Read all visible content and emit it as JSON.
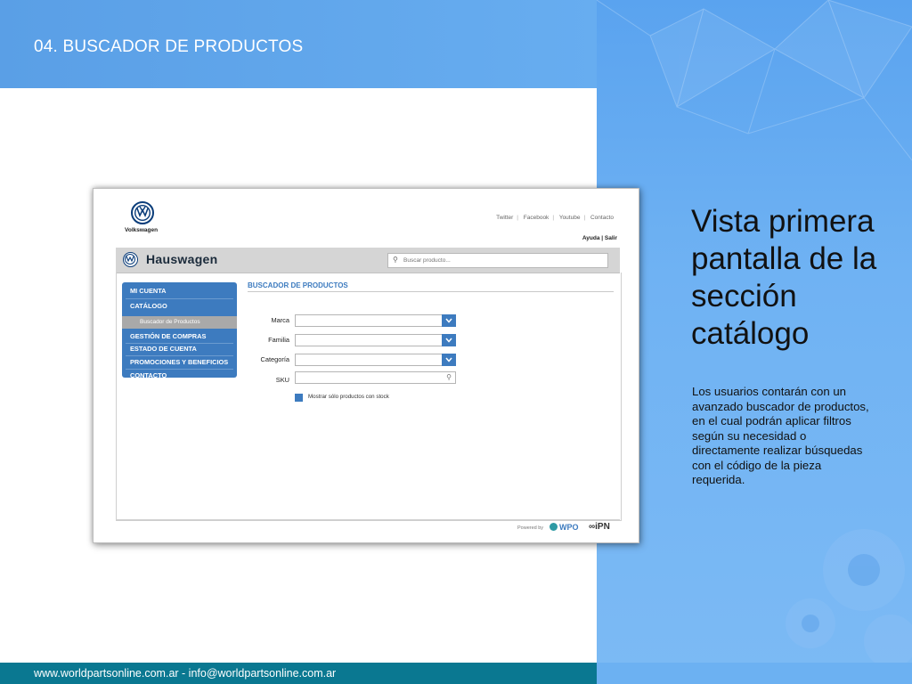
{
  "slide": {
    "section_title": "04. BUSCADOR DE PRODUCTOS",
    "headline": "Vista primera pantalla de la sección catálogo",
    "body": "Los usuarios contarán con un avanzado buscador de productos, en el cual podrán aplicar filtros según su necesidad o directamente realizar búsquedas con el código de la pieza requerida.",
    "footer": "www.worldpartsonline.com.ar - info@worldpartsonline.com.ar"
  },
  "colors": {
    "accent_blue": "#3d7bbf",
    "panel_blue": "#6cb1f2",
    "footer_teal": "#0a7891"
  },
  "app": {
    "brand": "Volkswagen",
    "top_links": [
      "Twitter",
      "Facebook",
      "Youtube",
      "Contacto"
    ],
    "account_links": "Ayuda | Salir",
    "name": "Hauswagen",
    "search": {
      "placeholder": "Buscar producto...",
      "value": ""
    },
    "sidebar": {
      "items": [
        "MI CUENTA",
        "CATÁLOGO",
        "GESTIÓN DE COMPRAS",
        "ESTADO DE CUENTA",
        "PROMOCIONES Y BENEFICIOS",
        "CONTACTO"
      ],
      "subitem": "Buscador de Productos"
    },
    "section_title": "BUSCADOR DE PRODUCTOS",
    "filters": {
      "marca_label": "Marca",
      "familia_label": "Familia",
      "categoria_label": "Categoría",
      "sku_label": "SKU",
      "marca_value": "",
      "familia_value": "",
      "categoria_value": "",
      "sku_value": ""
    },
    "stock_checkbox": {
      "label": "Mostrar sólo productos con stock",
      "checked": true
    },
    "powered_by": "Powered by",
    "partner_logos": [
      "WPO",
      "iPN"
    ]
  },
  "icons": [
    "vw-logo-icon",
    "search-icon",
    "chevron-down-icon"
  ]
}
